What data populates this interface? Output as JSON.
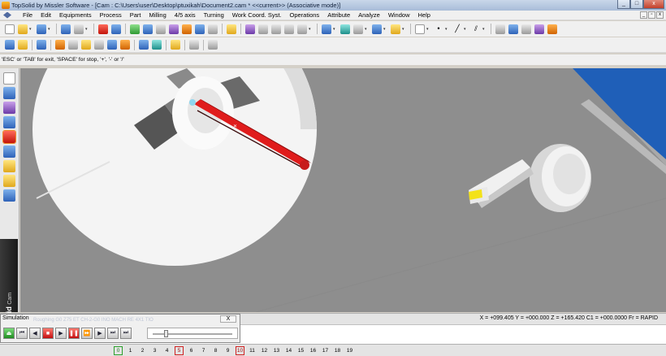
{
  "window": {
    "title": "TopSolid by Missler Software - [Cam : C:\\Users\\user\\Desktop\\ptuxikah\\Document2.cam *  <<current>> (Associative mode)]",
    "controls": [
      "minimize-icon",
      "maximize-icon",
      "close-icon"
    ]
  },
  "menu": {
    "items": [
      "File",
      "Edit",
      "Equipments",
      "Process",
      "Part",
      "Milling",
      "4/5 axis",
      "Turning",
      "Work Coord. Syst.",
      "Operations",
      "Attribute",
      "Analyze",
      "Window",
      "Help"
    ]
  },
  "prompt": {
    "text": "'ESC' or 'TAB' for exit, 'SPACE' for stop, '+', '-' or '/'"
  },
  "brand": {
    "name": "TopSolid",
    "module": "Cam"
  },
  "status": {
    "coords": "X = +099.405  Y = +000.000  Z = +165.420  C1 = +000.0000  Fr = RAPID"
  },
  "simulation": {
    "title": "Simulation",
    "close": "X",
    "ghost_text": "Roughing  G0 Z75 ET CH-2-G0 INO MACH RE 4X1 TIO",
    "slider_position": 0.15
  },
  "pens": {
    "numbers": [
      "0",
      "1",
      "2",
      "3",
      "4",
      "5",
      "6",
      "7",
      "8",
      "9",
      "10",
      "11",
      "12",
      "13",
      "14",
      "15",
      "16",
      "17",
      "18",
      "19"
    ],
    "selected_green": "0",
    "selected_red": [
      "5",
      "10"
    ]
  },
  "colors": {
    "tool_red": "#e01c1c",
    "part_yellow": "#f3e21a",
    "edge_blue": "#1f5fb8"
  }
}
